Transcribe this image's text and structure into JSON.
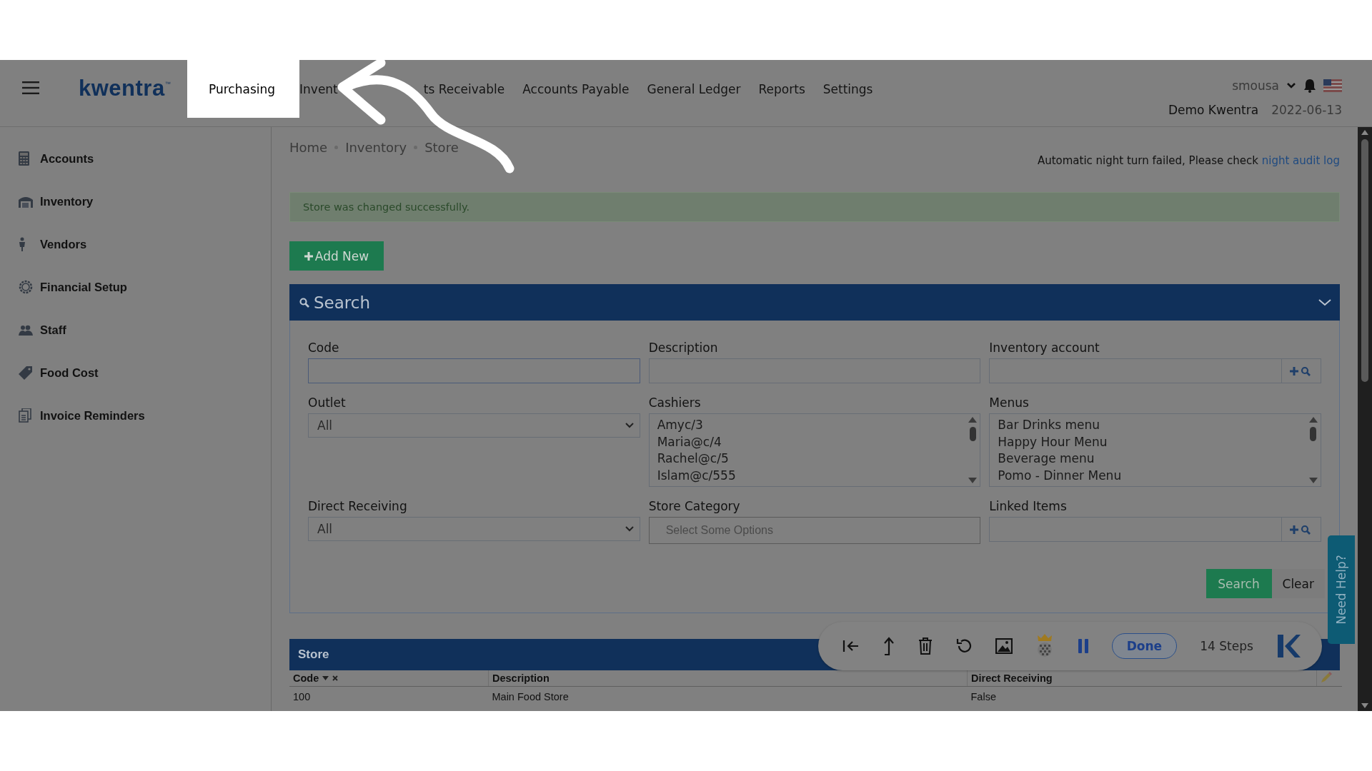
{
  "top_bar": {
    "logo": "kwentra$^{™}$",
    "nav": [
      {
        "label": "Purchasing",
        "selected": true
      },
      {
        "label": "Invent",
        "selected": false
      },
      {
        "label": "ts Receivable",
        "selected": false
      },
      {
        "label": "Accounts Payable",
        "selected": false
      },
      {
        "label": "General Ledger",
        "selected": false
      },
      {
        "label": "Reports",
        "selected": false
      },
      {
        "label": "Settings",
        "selected": false
      }
    ],
    "user": "smousa",
    "company": "Demo Kwentra",
    "date": "2022-06-13"
  },
  "sidebar": {
    "items": [
      {
        "label": "Accounts"
      },
      {
        "label": "Inventory"
      },
      {
        "label": "Vendors"
      },
      {
        "label": "Financial Setup"
      },
      {
        "label": "Staff"
      },
      {
        "label": "Food Cost"
      },
      {
        "label": "Invoice Reminders"
      }
    ]
  },
  "breadcrumb": [
    "Home",
    "Inventory",
    "Store"
  ],
  "notice": {
    "text": "Automatic night turn failed, Please check",
    "link": "night audit log"
  },
  "alert": "Store was changed successfully.",
  "add_button": "Add New",
  "search_panel": {
    "title": "Search",
    "fields": [
      {
        "label": "Code",
        "kind": "text"
      },
      {
        "label": "Description",
        "kind": "text"
      },
      {
        "label": "Inventory account",
        "kind": "lookup"
      },
      {
        "label": "Outlet",
        "kind": "select",
        "value": "All"
      },
      {
        "label": "Cashiers",
        "kind": "list",
        "options": [
          "Amyc/3",
          "Maria@c/4",
          "Rachel@c/5",
          "Islam@c/555"
        ]
      },
      {
        "label": "Menus",
        "kind": "list",
        "options": [
          "Bar Drinks menu",
          "Happy Hour Menu",
          "Beverage menu",
          "Pomo - Dinner Menu"
        ]
      },
      {
        "label": "Direct Receiving",
        "kind": "select",
        "value": "All"
      },
      {
        "label": "Store Category",
        "kind": "multi",
        "placeholder": "Select Some Options"
      },
      {
        "label": "Linked Items",
        "kind": "lookup"
      }
    ],
    "buttons": [
      {
        "label": "Search",
        "kind": "primary"
      },
      {
        "label": "Clear",
        "kind": "plain"
      }
    ]
  },
  "table": {
    "title": "Store",
    "columns": [
      "Code",
      "Description",
      "Direct Receiving"
    ],
    "rows": [
      [
        "100",
        "Main Food Store",
        "False"
      ]
    ]
  },
  "recorder": {
    "done": "Done",
    "steps": "14 Steps"
  },
  "help_tab": "Need Help?"
}
